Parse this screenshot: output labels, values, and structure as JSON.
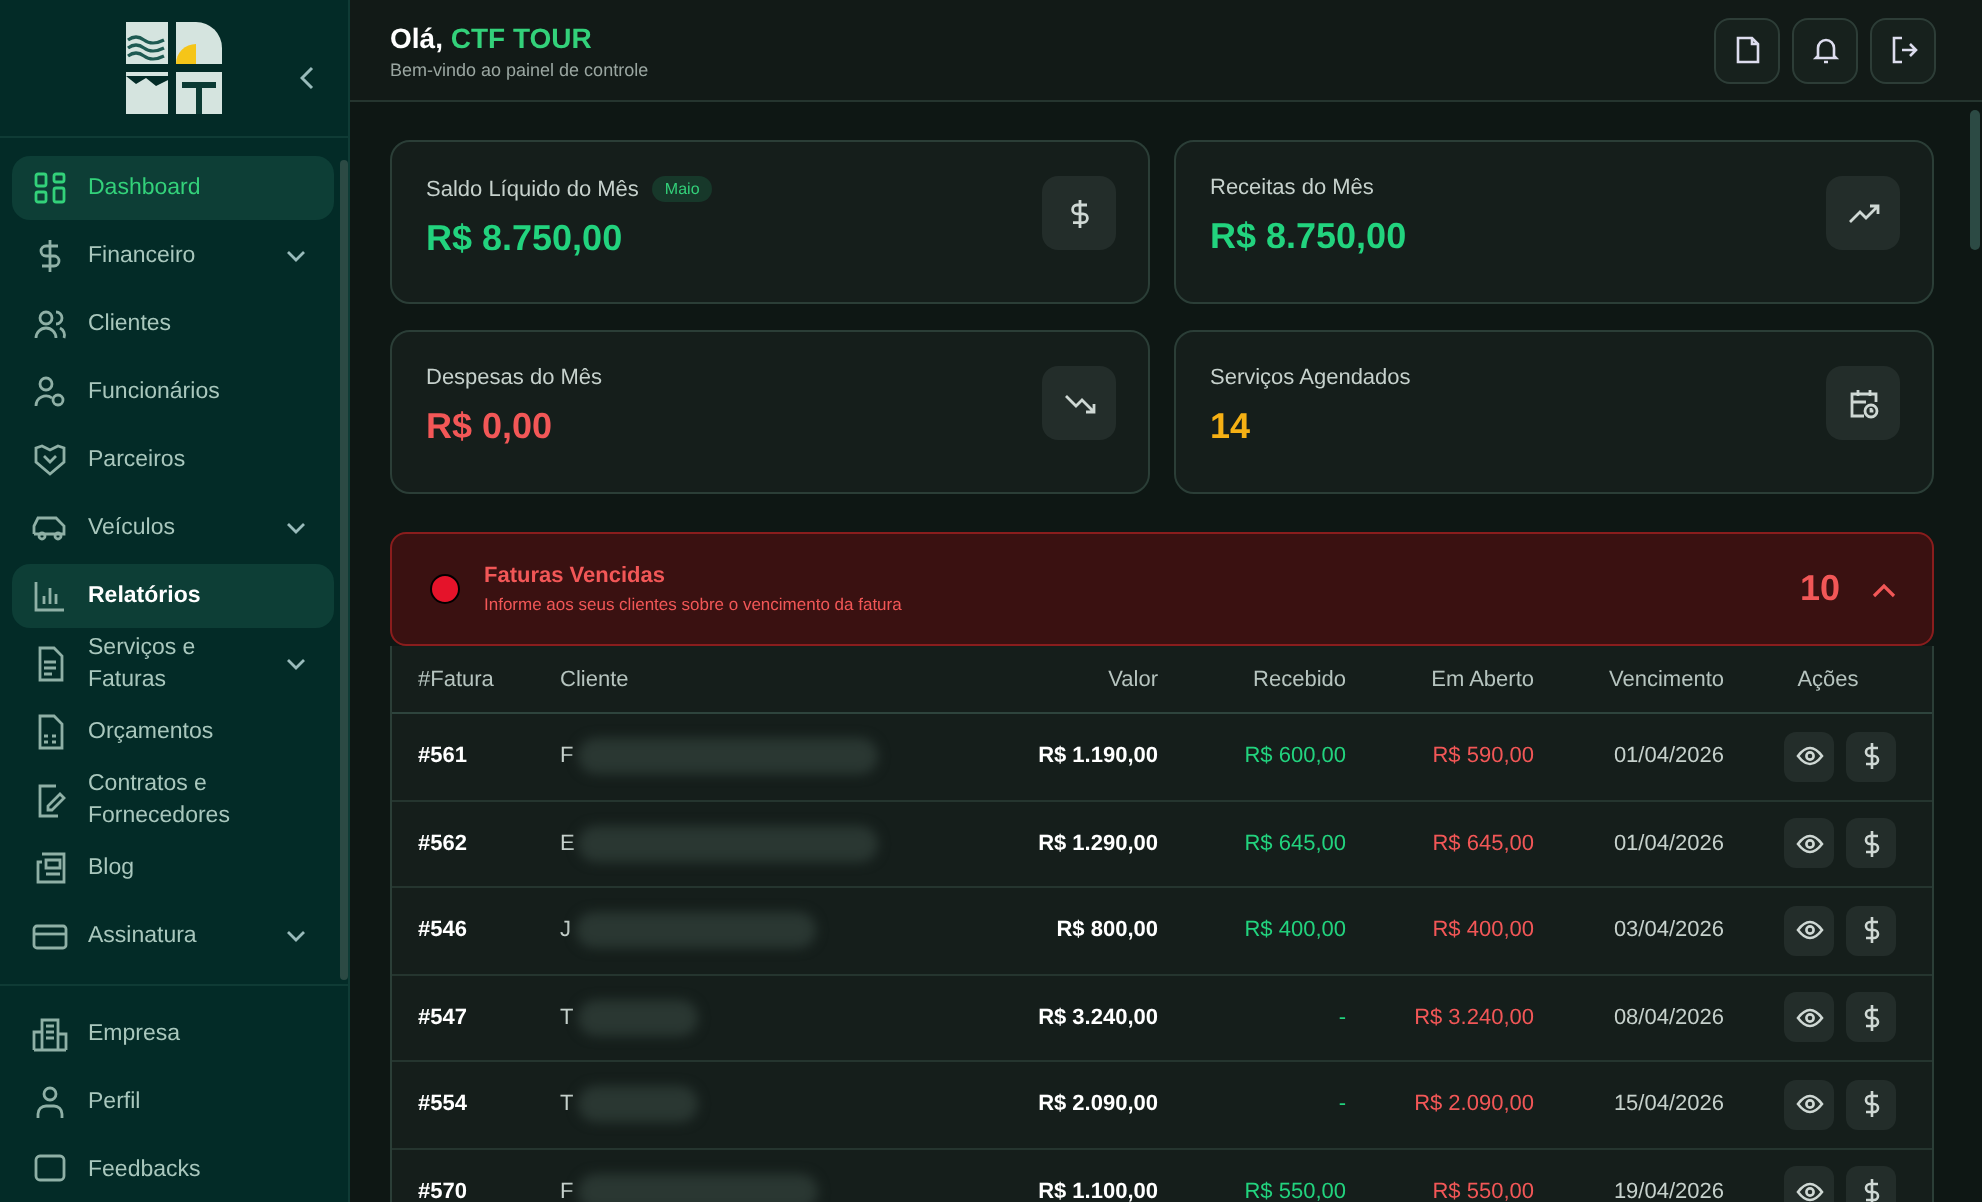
{
  "sidebar": {
    "items": [
      {
        "label": "Dashboard",
        "selected": true,
        "highlighted": false,
        "has_submenu": false
      },
      {
        "label": "Financeiro",
        "selected": false,
        "highlighted": false,
        "has_submenu": true
      },
      {
        "label": "Clientes",
        "selected": false,
        "highlighted": false,
        "has_submenu": false
      },
      {
        "label": "Funcionários",
        "selected": false,
        "highlighted": false,
        "has_submenu": false
      },
      {
        "label": "Parceiros",
        "selected": false,
        "highlighted": false,
        "has_submenu": false
      },
      {
        "label": "Veículos",
        "selected": false,
        "highlighted": false,
        "has_submenu": true
      },
      {
        "label": "Relatórios",
        "selected": false,
        "highlighted": true,
        "has_submenu": false
      },
      {
        "label": "Serviços e Faturas",
        "selected": false,
        "highlighted": false,
        "has_submenu": true
      },
      {
        "label": "Orçamentos",
        "selected": false,
        "highlighted": false,
        "has_submenu": false
      },
      {
        "label": "Contratos e Fornecedores",
        "selected": false,
        "highlighted": false,
        "has_submenu": false
      },
      {
        "label": "Blog",
        "selected": false,
        "highlighted": false,
        "has_submenu": false
      },
      {
        "label": "Assinatura",
        "selected": false,
        "highlighted": false,
        "has_submenu": true
      }
    ],
    "footer_items": [
      {
        "label": "Empresa"
      },
      {
        "label": "Perfil"
      },
      {
        "label": "Feedbacks"
      }
    ]
  },
  "header": {
    "greeting": "Olá,",
    "user": "CTF TOUR",
    "subtitle": "Bem-vindo ao painel de controle"
  },
  "cards": [
    {
      "title": "Saldo Líquido do Mês",
      "badge": "Maio",
      "value": "R$ 8.750,00",
      "kind": "positive"
    },
    {
      "title": "Receitas do Mês",
      "value": "R$ 8.750,00",
      "kind": "positive"
    },
    {
      "title": "Despesas do Mês",
      "value": "R$ 0,00",
      "kind": "negative"
    },
    {
      "title": "Serviços Agendados",
      "value": "14",
      "kind": "count"
    }
  ],
  "alert": {
    "title": "Faturas Vencidas",
    "message": "Informe aos seus clientes sobre o vencimento da fatura",
    "count": "10",
    "expanded": true
  },
  "table": {
    "columns": [
      "#Fatura",
      "Cliente",
      "Valor",
      "Recebido",
      "Em Aberto",
      "Vencimento",
      "Ações"
    ],
    "rows": [
      {
        "invoice": "#561",
        "client": "F",
        "value": "R$ 1.190,00",
        "received": "R$ 600,00",
        "open": "R$ 590,00",
        "due": "01/04/2026"
      },
      {
        "invoice": "#562",
        "client": "E",
        "value": "R$ 1.290,00",
        "received": "R$ 645,00",
        "open": "R$ 645,00",
        "due": "01/04/2026"
      },
      {
        "invoice": "#546",
        "client": "J",
        "value": "R$ 800,00",
        "received": "R$ 400,00",
        "open": "R$ 400,00",
        "due": "03/04/2026"
      },
      {
        "invoice": "#547",
        "client": "T",
        "value": "R$ 3.240,00",
        "received": "-",
        "open": "R$ 3.240,00",
        "due": "08/04/2026"
      },
      {
        "invoice": "#554",
        "client": "T",
        "value": "R$ 2.090,00",
        "received": "-",
        "open": "R$ 2.090,00",
        "due": "15/04/2026"
      },
      {
        "invoice": "#570",
        "client": "F",
        "value": "R$ 1.100,00",
        "received": "R$ 550,00",
        "open": "R$ 550,00",
        "due": "19/04/2026"
      }
    ]
  }
}
